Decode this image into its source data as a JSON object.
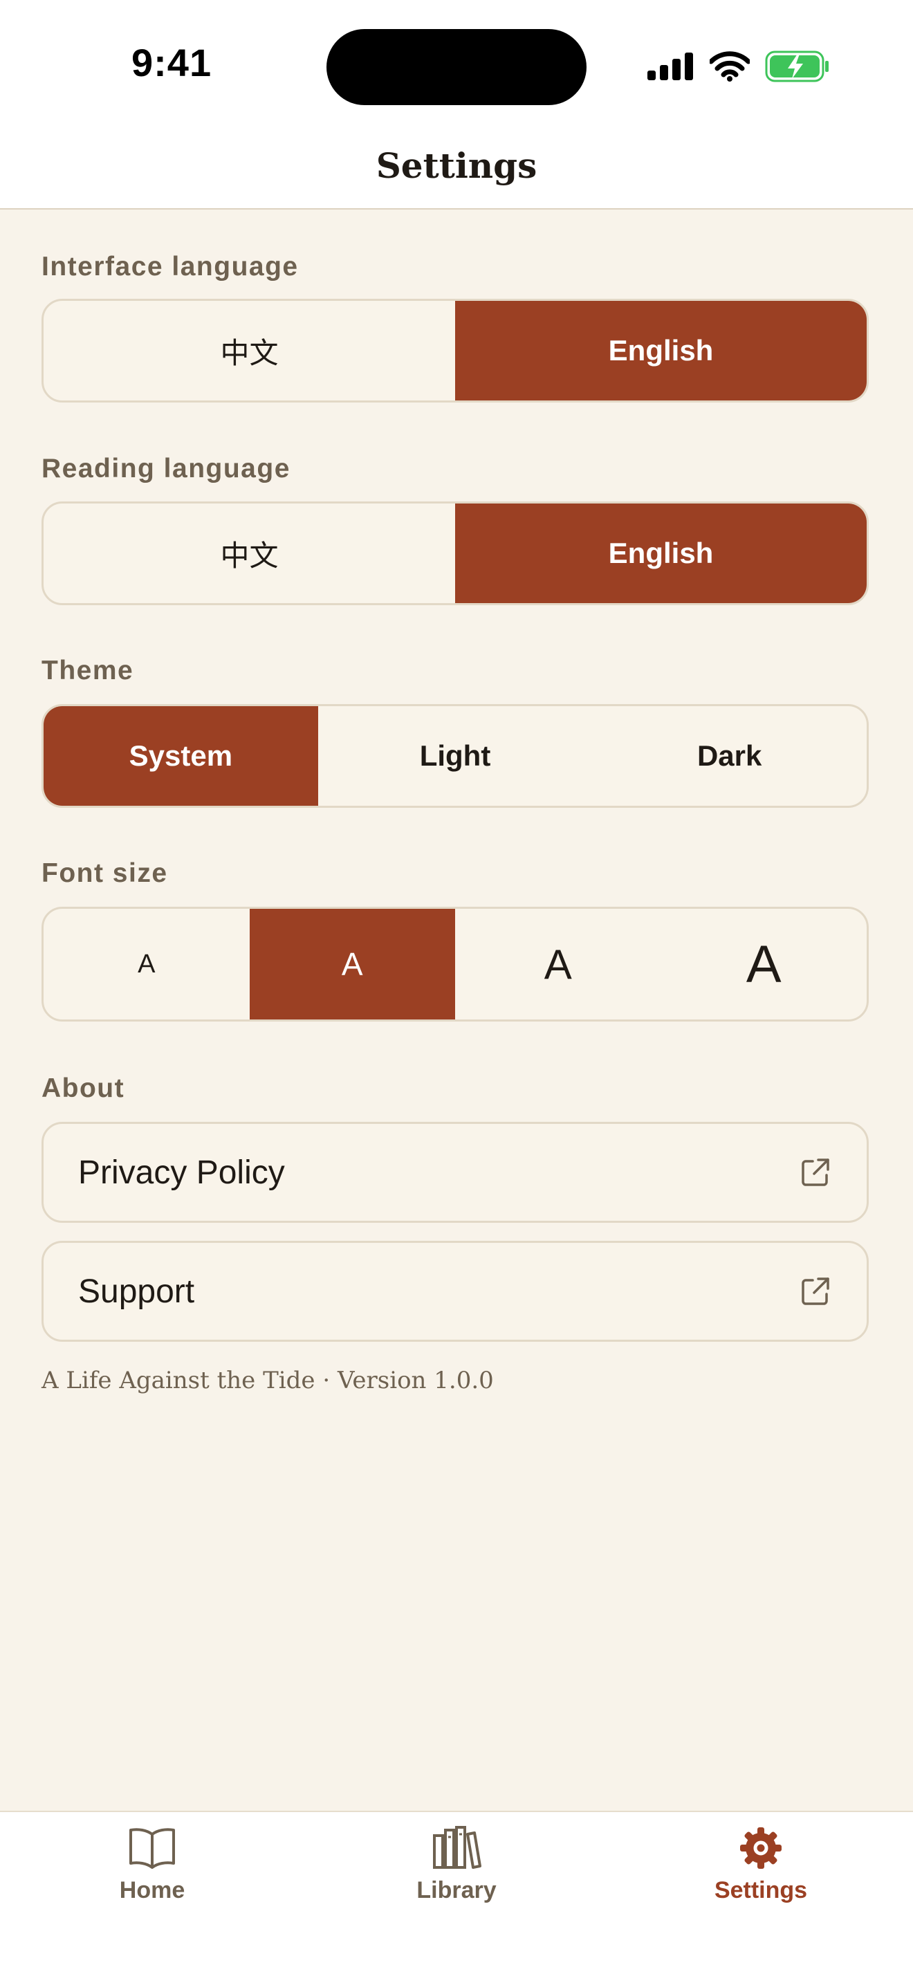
{
  "status": {
    "time": "9:41"
  },
  "header": {
    "title": "Settings"
  },
  "sections": {
    "interface_language": {
      "label": "Interface language",
      "options": [
        "中文",
        "English"
      ],
      "selected": "English"
    },
    "reading_language": {
      "label": "Reading language",
      "options": [
        "中文",
        "English"
      ],
      "selected": "English"
    },
    "theme": {
      "label": "Theme",
      "options": [
        "System",
        "Light",
        "Dark"
      ],
      "selected": "System"
    },
    "font_size": {
      "label": "Font size",
      "options": [
        "A",
        "A",
        "A",
        "A"
      ],
      "selected_index": 1
    },
    "about": {
      "label": "About",
      "links": [
        "Privacy Policy",
        "Support"
      ]
    }
  },
  "footer": {
    "text": "A Life Against the Tide · Version 1.0.0"
  },
  "tabbar": {
    "tabs": [
      "Home",
      "Library",
      "Settings"
    ],
    "active": "Settings"
  },
  "colors": {
    "accent": "#9b4023",
    "background": "#f8f3ea",
    "border": "#e2d8c6",
    "battery": "#3ec45a"
  },
  "icons": [
    "signal-icon",
    "wifi-icon",
    "battery-charging-icon",
    "external-link-icon",
    "book-icon",
    "library-icon",
    "gear-icon"
  ]
}
